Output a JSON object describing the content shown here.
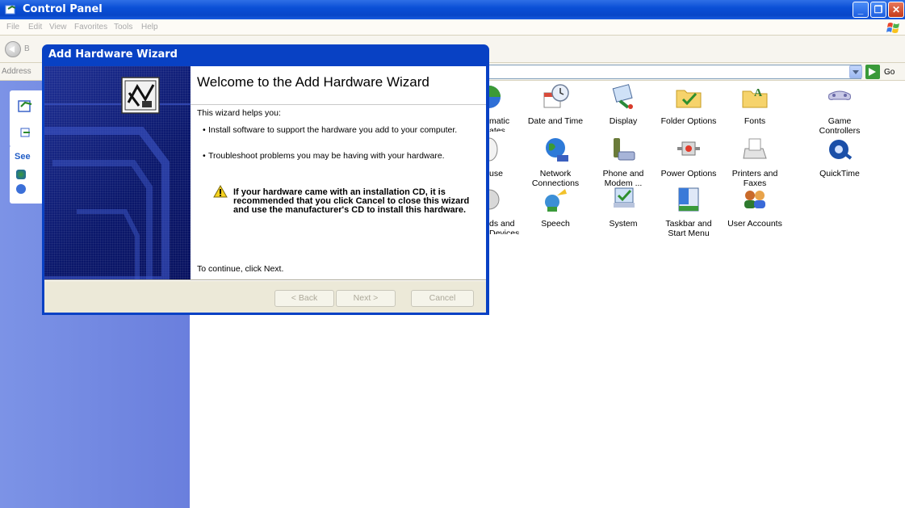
{
  "window": {
    "title": "Control Panel",
    "menu": [
      "File",
      "Edit",
      "View",
      "Favorites",
      "Tools",
      "Help"
    ],
    "back_label": "B",
    "address_label": "Address",
    "go_label": "Go"
  },
  "left_pane": {
    "see_also_label": "See"
  },
  "control_panel_items": [
    {
      "label": "matic\nates",
      "icon": "automatic-updates-icon"
    },
    {
      "label": "Date and Time",
      "icon": "date-time-icon"
    },
    {
      "label": "Display",
      "icon": "display-icon"
    },
    {
      "label": "Folder Options",
      "icon": "folder-options-icon"
    },
    {
      "label": "Fonts",
      "icon": "fonts-folder-icon"
    },
    {
      "label": "Game\nControllers",
      "icon": "game-controller-icon"
    },
    {
      "label": "use",
      "icon": "mouse-icon"
    },
    {
      "label": "Network\nConnections",
      "icon": "network-globe-icon"
    },
    {
      "label": "Phone and\nModem ...",
      "icon": "phone-modem-icon"
    },
    {
      "label": "Power Options",
      "icon": "power-options-icon"
    },
    {
      "label": "Printers and\nFaxes",
      "icon": "printer-icon"
    },
    {
      "label": "QuickTime",
      "icon": "quicktime-icon"
    },
    {
      "label": "ds and\nDevices",
      "icon": "sounds-devices-icon"
    },
    {
      "label": "Speech",
      "icon": "speech-icon"
    },
    {
      "label": "System",
      "icon": "system-icon"
    },
    {
      "label": "Taskbar and\nStart Menu",
      "icon": "taskbar-icon"
    },
    {
      "label": "User Accounts",
      "icon": "user-accounts-icon"
    }
  ],
  "wizard": {
    "title": "Add Hardware Wizard",
    "heading": "Welcome to the Add Hardware Wizard",
    "intro": "This wizard helps you:",
    "bullet1": "Install software to support the hardware you add to your computer.",
    "bullet2": "Troubleshoot problems you may be having with your hardware.",
    "warning": "If your hardware came with an installation CD, it is recommended that you click Cancel to close this wizard and use the manufacturer's CD to install this hardware.",
    "continue": "To continue, click Next.",
    "back_button": "< Back",
    "next_button": "Next >",
    "cancel_button": "Cancel"
  },
  "colors": {
    "titlebar": "#0a4fd6",
    "left_pane": "#7086e0",
    "wizard_side": "#0a176b",
    "dialog_face": "#ece9d8"
  }
}
